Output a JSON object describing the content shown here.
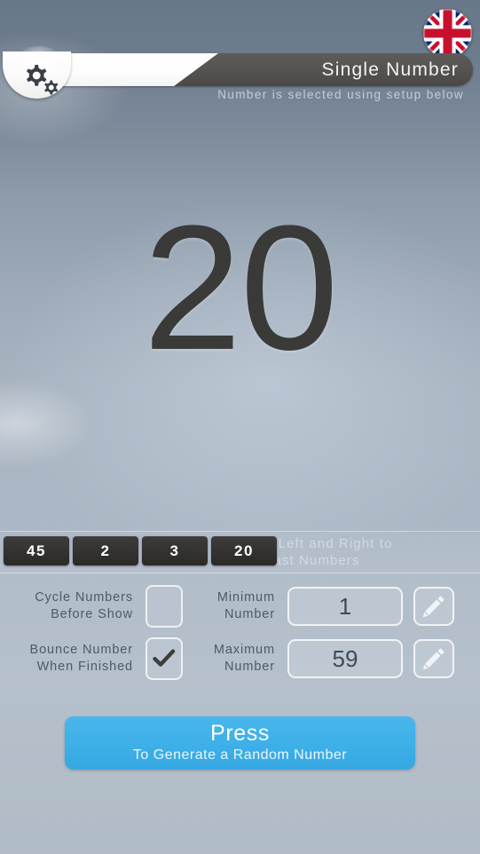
{
  "app": {
    "mode_title": "Single  Number",
    "mode_subtitle": "Number  is  selected  using  setup  below"
  },
  "flag": {
    "icon": "uk-flag-icon",
    "label": "United Kingdom"
  },
  "settings_tab": {
    "icon": "gears-icon"
  },
  "display": {
    "current_number": "20"
  },
  "history": {
    "swipe_hint": "Swipe Left and Right to\nSee Past Numbers",
    "chips": [
      "45",
      "2",
      "3",
      "20"
    ]
  },
  "settings": {
    "cycle": {
      "label": "Cycle  Numbers\nBefore  Show",
      "checked": false,
      "check_glyph": ""
    },
    "bounce": {
      "label": "Bounce  Number\nWhen  Finished",
      "checked": true,
      "check_glyph": "check-icon"
    },
    "minimum": {
      "label": "Minimum\nNumber",
      "value": "1",
      "edit_icon": "pencil-icon"
    },
    "maximum": {
      "label": "Maximum\nNumber",
      "value": "59",
      "edit_icon": "pencil-icon"
    }
  },
  "action": {
    "main_label": "Press",
    "sub_label": "To Generate a Random Number",
    "color": "#3fb0e8"
  }
}
